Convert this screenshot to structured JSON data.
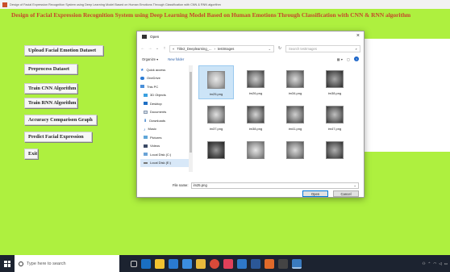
{
  "window": {
    "title": "Design of Facial Expression Recognition System using Deep Learning Model Based on Human Emotions Through Classification with CNN & RNN algorithm"
  },
  "app": {
    "heading": "Design of Facial Expression Recognition System using Deep Learning Model Based on Human Emotions Through Classification with CNN & RNN algorithm",
    "buttons": [
      "Upload Facial Emotion Dataset",
      "Preprocess Dataset",
      "Train CNN Algorithm",
      "Train RNN Algorithm",
      "Accuracy Comparison Graph",
      "Predict Facial Expression",
      "Exit"
    ],
    "colors": {
      "background": "#aef03f",
      "heading": "#c5462a"
    }
  },
  "dialog": {
    "title": "Open",
    "close": "×",
    "path": [
      "Title2_Deeplearning_...",
      "testImages"
    ],
    "search_placeholder": "Search testImages",
    "toolbar": {
      "organize": "Organize ▾",
      "new_folder": "New folder"
    },
    "nav": [
      "Quick access",
      "OneDrive",
      "This PC",
      "3D Objects",
      "Desktop",
      "Documents",
      "Downloads",
      "Music",
      "Pictures",
      "Videos",
      "Local Disk (C:)",
      "Local Disk (E:)"
    ],
    "files": [
      "im25.png",
      "im26.png",
      "im34.png",
      "im38.png",
      "im37.png",
      "im38.png",
      "im41.png",
      "im47.png",
      "",
      "",
      "",
      ""
    ],
    "file_name_label": "File name:",
    "file_name_value": "im25.png",
    "open_label": "Open",
    "cancel_label": "Cancel"
  },
  "taskbar": {
    "search_placeholder": "Type here to search",
    "icons": [
      "task-view-icon",
      "edge-icon",
      "file-explorer-icon",
      "store-icon",
      "ie-icon",
      "folder-icon",
      "chrome-icon",
      "music-icon",
      "mail-icon",
      "word-icon",
      "java-icon",
      "terminal-icon",
      "python-icon"
    ]
  }
}
